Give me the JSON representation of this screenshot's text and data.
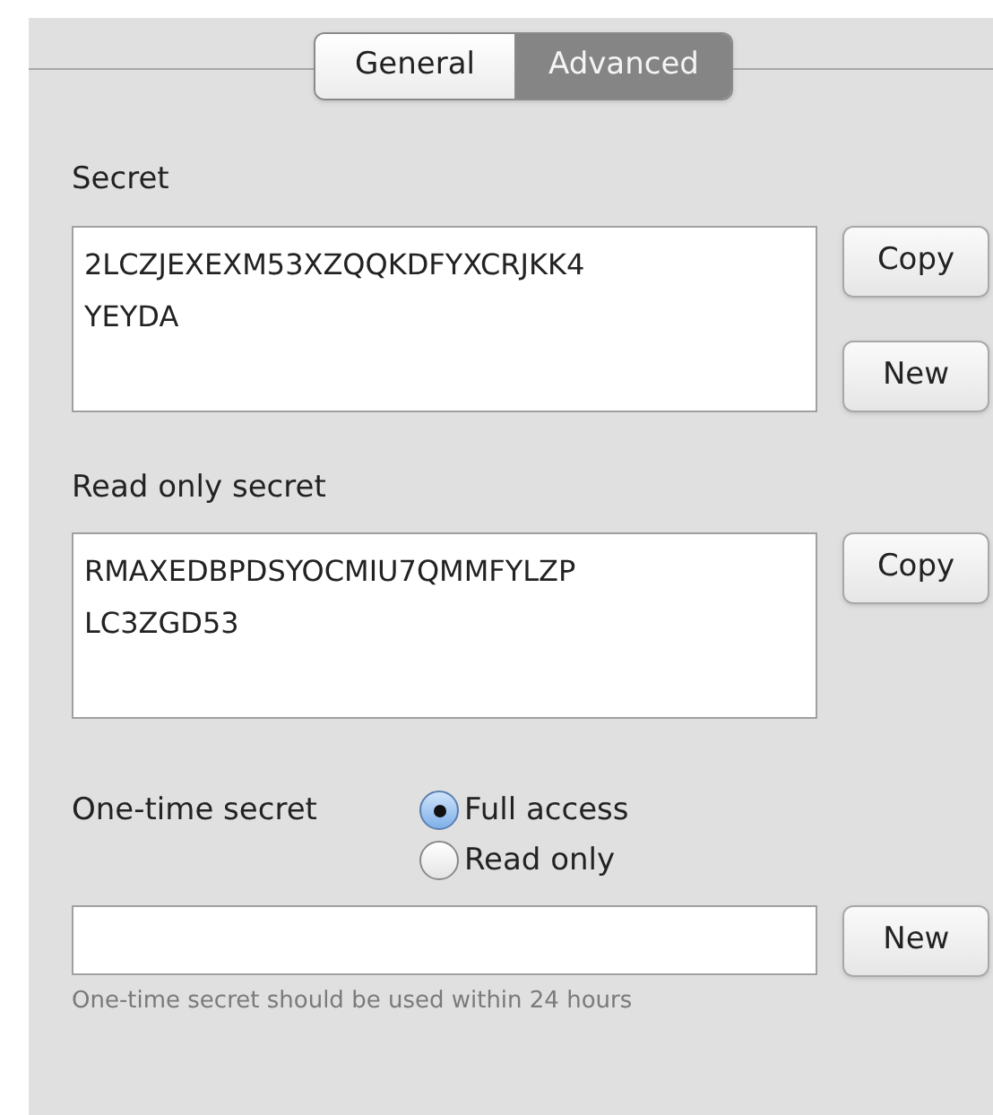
{
  "tabs": [
    {
      "label": "General",
      "selected": false
    },
    {
      "label": "Advanced",
      "selected": true
    }
  ],
  "secret": {
    "label": "Secret",
    "value_lines": [
      "2LCZJEXEXM53XZQQKDFYXCRJKK4",
      "YEYDA"
    ],
    "buttons": [
      "Copy",
      "New"
    ]
  },
  "read_only_secret": {
    "label": "Read only secret",
    "value_lines": [
      "RMAXEDBPDSYOCMIU7QMMFYLZP",
      "LC3ZGD53"
    ],
    "buttons": [
      "Copy"
    ]
  },
  "one_time_secret": {
    "label": "One-time secret",
    "options": [
      {
        "label": "Full access",
        "selected": true
      },
      {
        "label": "Read only",
        "selected": false
      }
    ],
    "button": "New",
    "hint": "One-time secret should be used within 24 hours"
  }
}
